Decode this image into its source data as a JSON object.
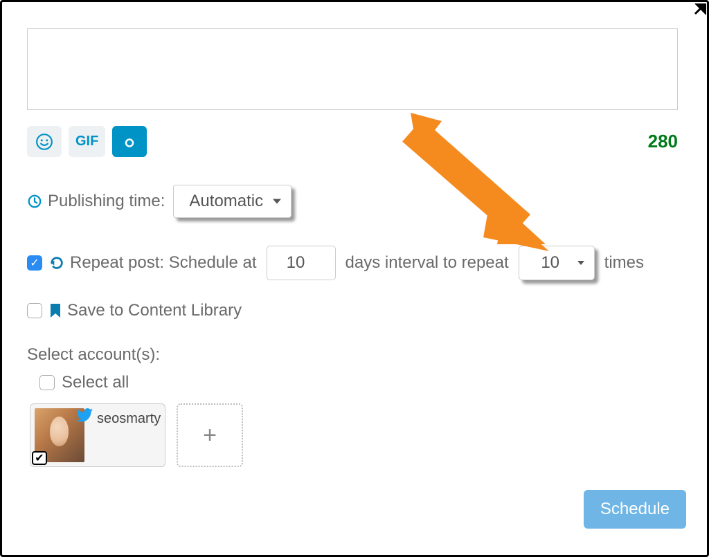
{
  "composer": {
    "text": "",
    "placeholder": ""
  },
  "toolbar": {
    "gif_label": "GIF"
  },
  "counter": "280",
  "publishing": {
    "label": "Publishing time:",
    "value": "Automatic"
  },
  "repeat": {
    "checked": true,
    "label_prefix": "Repeat post: Schedule at",
    "days_value": "10",
    "label_mid": "days interval to repeat",
    "times_value": "10",
    "label_suffix": "times"
  },
  "library": {
    "checked": false,
    "label": "Save to Content Library"
  },
  "accounts": {
    "heading": "Select account(s):",
    "select_all_label": "Select all",
    "items": [
      {
        "name": "seosmarty",
        "network": "twitter",
        "selected": true
      }
    ]
  },
  "schedule_button": "Schedule"
}
